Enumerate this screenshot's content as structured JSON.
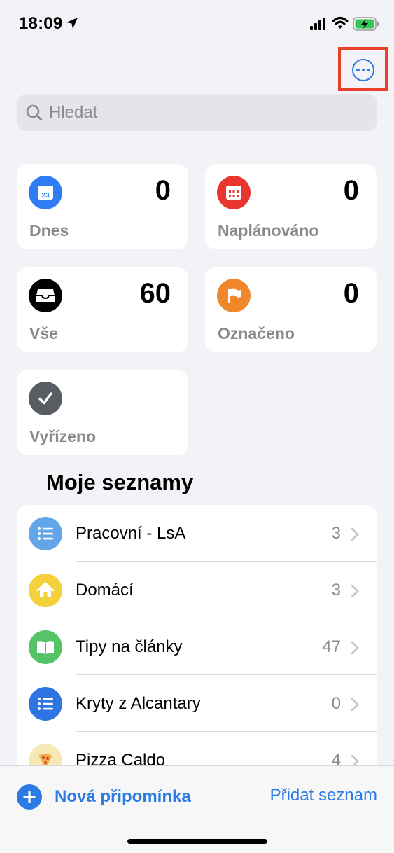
{
  "status": {
    "time": "18:09"
  },
  "search": {
    "placeholder": "Hledat"
  },
  "smart_lists": [
    {
      "label": "Dnes",
      "count": "0",
      "color": "#2e7cf6",
      "icon": "calendar-icon",
      "icon_text": "23"
    },
    {
      "label": "Naplánováno",
      "count": "0",
      "color": "#e8362f",
      "icon": "calendar-grid-icon"
    },
    {
      "label": "Vše",
      "count": "60",
      "color": "#000000",
      "icon": "tray-icon"
    },
    {
      "label": "Označeno",
      "count": "0",
      "color": "#f0882b",
      "icon": "flag-icon"
    },
    {
      "label": "Vyřízeno",
      "count": "",
      "color": "#595d63",
      "icon": "checkmark-icon"
    }
  ],
  "my_lists": {
    "title": "Moje seznamy",
    "items": [
      {
        "name": "Pracovní - LsA",
        "count": "3",
        "color": "#62a6e9",
        "icon": "list-icon"
      },
      {
        "name": "Domácí",
        "count": "3",
        "color": "#f2d13c",
        "icon": "house-icon"
      },
      {
        "name": "Tipy na články",
        "count": "47",
        "color": "#55c467",
        "icon": "book-icon"
      },
      {
        "name": "Kryty z Alcantary",
        "count": "0",
        "color": "#2e74e3",
        "icon": "list-icon"
      },
      {
        "name": "Pizza Caldo",
        "count": "4",
        "color": "#f7e9b5",
        "icon": "pizza-icon"
      }
    ]
  },
  "toolbar": {
    "new_reminder": "Nová připomínka",
    "add_list": "Přidat seznam"
  },
  "colors": {
    "accent": "#2c7be5",
    "highlight": "#e8402a"
  }
}
